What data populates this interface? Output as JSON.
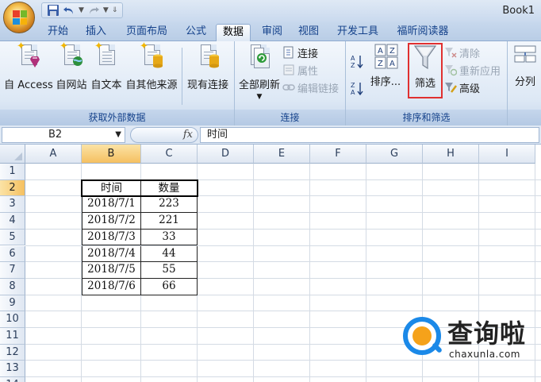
{
  "window": {
    "title": "Book1"
  },
  "tabs": [
    "开始",
    "插入",
    "页面布局",
    "公式",
    "数据",
    "审阅",
    "视图",
    "开发工具",
    "福昕阅读器"
  ],
  "active_tab": "数据",
  "ribbon": {
    "get_external_data": {
      "label": "获取外部数据",
      "buttons": [
        "自 Access",
        "自网站",
        "自文本",
        "自其他来源",
        "现有连接"
      ]
    },
    "connections": {
      "label": "连接",
      "refresh_all": "全部刷新",
      "connections": "连接",
      "properties": "属性",
      "edit_links": "编辑链接"
    },
    "sort_filter": {
      "label": "排序和筛选",
      "sort": "排序...",
      "filter": "筛选",
      "clear": "清除",
      "reapply": "重新应用",
      "advanced": "高级",
      "highlight_color": "#e03030"
    },
    "data_tools": {
      "text_to_columns": "分列"
    }
  },
  "formula_bar": {
    "name_box": "B2",
    "fx": "fx",
    "content": "时间"
  },
  "sheet": {
    "columns": [
      "A",
      "B",
      "C",
      "D",
      "E",
      "F",
      "G",
      "H",
      "I"
    ],
    "rows": [
      "1",
      "2",
      "3",
      "4",
      "5",
      "6",
      "7",
      "8",
      "9",
      "10",
      "11",
      "12",
      "13",
      "14"
    ],
    "selected_cell": "B2",
    "table": {
      "headers": [
        "时间",
        "数量"
      ],
      "rows": [
        [
          "2018/7/1",
          "223"
        ],
        [
          "2018/7/2",
          "221"
        ],
        [
          "2018/7/3",
          "33"
        ],
        [
          "2018/7/4",
          "44"
        ],
        [
          "2018/7/5",
          "55"
        ],
        [
          "2018/7/6",
          "66"
        ]
      ]
    }
  },
  "watermark": {
    "cn": "查询啦",
    "en": "chaxunla.com"
  }
}
